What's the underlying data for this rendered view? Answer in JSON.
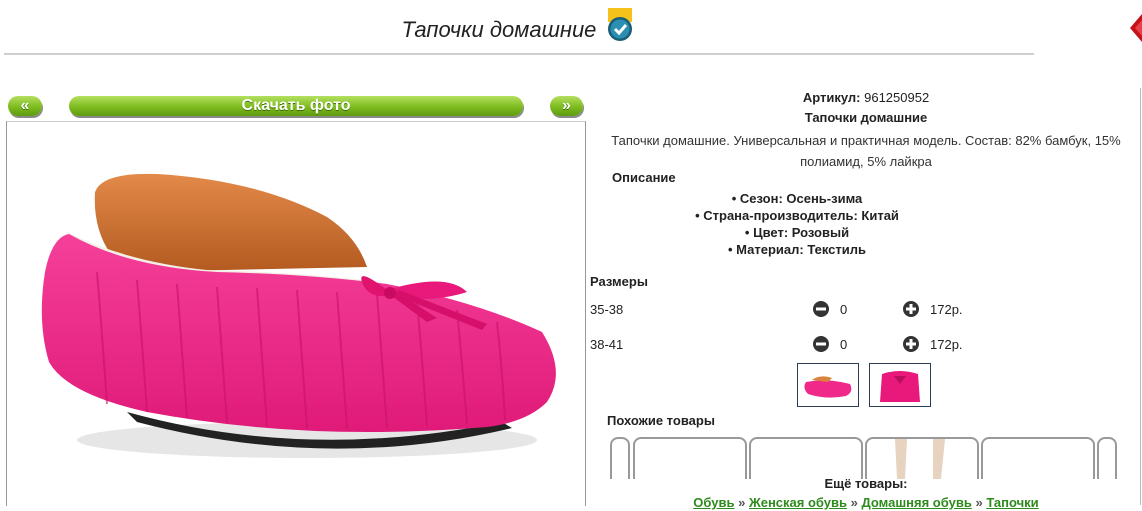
{
  "page": {
    "title": "Тапочки домашние",
    "badge_icon": "verified-check-badge-icon",
    "corner_icon": "red-arrow-icon"
  },
  "nav": {
    "prev_label": "«",
    "download_label": "Скачать фото",
    "next_label": "»"
  },
  "product": {
    "article_label": "Артикул:",
    "article_value": "961250952",
    "name": "Тапочки домашние",
    "description": "Тапочки домашние. Универсальная и практичная модель. Состав: 82% бамбук, 15% полиамид, 5% лайкра",
    "description_heading": "Описание",
    "attributes": [
      "Сезон: Осень-зима",
      "Страна-производитель: Китай",
      "Цвет: Розовый",
      "Материал: Текстиль"
    ]
  },
  "sizes": {
    "heading": "Размеры",
    "rows": [
      {
        "label": "35-38",
        "qty": "0",
        "price": "172р."
      },
      {
        "label": "38-41",
        "qty": "0",
        "price": "172р."
      }
    ]
  },
  "similar": {
    "heading": "Похожие товары"
  },
  "more": {
    "heading": "Ещё товары:",
    "breadcrumbs": [
      "Обувь",
      "Женская обувь",
      "Домашняя обувь",
      "Тапочки"
    ],
    "separator": "»"
  },
  "colors": {
    "button_green": "#7dbb1e",
    "slipper_pink": "#f0288a",
    "link_green": "#2e8b1c"
  }
}
